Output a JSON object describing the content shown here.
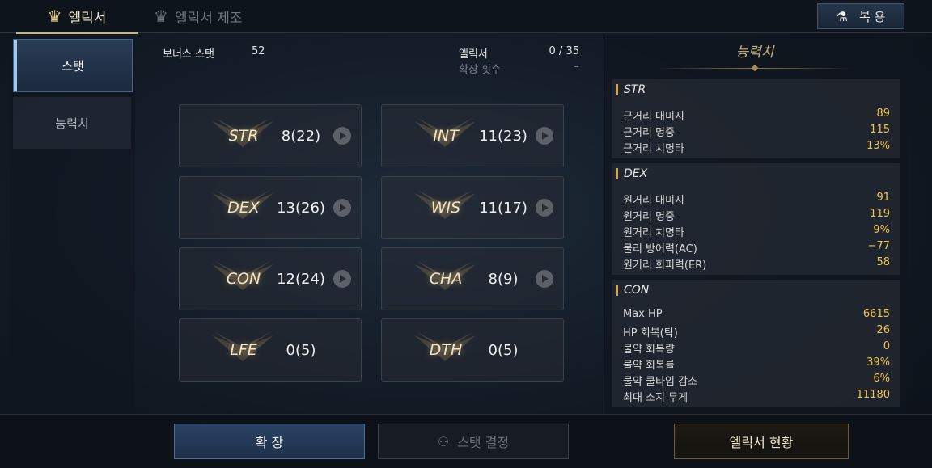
{
  "tabs": {
    "active": "엘릭서",
    "inactive": "엘릭서 제조"
  },
  "restore_button": "복 용",
  "sidebar": {
    "items": [
      "스탯",
      "능력치"
    ]
  },
  "header": {
    "bonus_stat_label": "보너스 스탯",
    "bonus_stat_value": "52",
    "elixir_label": "엘릭서",
    "elixir_value": "0 / 35",
    "expand_count_label": "확장 횟수",
    "expand_count_value": "–"
  },
  "stats": [
    {
      "name": "STR",
      "value": "8(22)"
    },
    {
      "name": "INT",
      "value": "11(23)"
    },
    {
      "name": "DEX",
      "value": "13(26)"
    },
    {
      "name": "WIS",
      "value": "11(17)"
    },
    {
      "name": "CON",
      "value": "12(24)"
    },
    {
      "name": "CHA",
      "value": "8(9)"
    },
    {
      "name": "LFE",
      "value": "0(5)"
    },
    {
      "name": "DTH",
      "value": "0(5)"
    }
  ],
  "ability_panel": {
    "title": "능력치",
    "sections": [
      {
        "title": "STR",
        "rows": [
          {
            "label": "근거리 대미지",
            "value": "89"
          },
          {
            "label": "근거리 명중",
            "value": "115"
          },
          {
            "label": "근거리 치명타",
            "value": "13%"
          }
        ]
      },
      {
        "title": "DEX",
        "rows": [
          {
            "label": "원거리 대미지",
            "value": "91"
          },
          {
            "label": "원거리 명중",
            "value": "119"
          },
          {
            "label": "원거리 치명타",
            "value": "9%"
          },
          {
            "label": "물리 방어력(AC)",
            "value": "−77"
          },
          {
            "label": "원거리 회피력(ER)",
            "value": "58"
          }
        ]
      },
      {
        "title": "CON",
        "rows": [
          {
            "label": "Max HP",
            "value": "6615"
          },
          {
            "label": "HP 회복(틱)",
            "value": "26"
          },
          {
            "label": "물약 회복량",
            "value": "0"
          },
          {
            "label": "물약 회복률",
            "value": "39%"
          },
          {
            "label": "물약 쿨타임 감소",
            "value": "6%"
          },
          {
            "label": "최대 소지 무게",
            "value": "11180"
          }
        ]
      }
    ]
  },
  "bottom": {
    "expand": "확 장",
    "decide": "스탯 결정",
    "status": "엘릭서 현황"
  },
  "colors": {
    "accent_gold": "#c9b37e",
    "value_yellow": "#f0c64c",
    "active_blue": "#2a3c56"
  }
}
